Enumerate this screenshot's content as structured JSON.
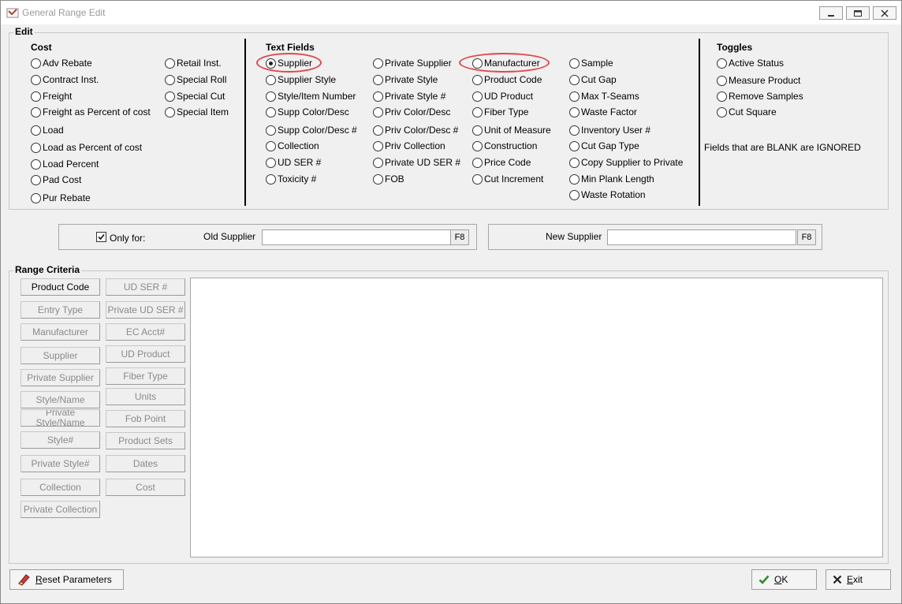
{
  "window": {
    "title": "General Range Edit"
  },
  "edit_group": {
    "legend": "Edit"
  },
  "cost": {
    "heading": "Cost",
    "col1": [
      "Adv Rebate",
      "Contract Inst.",
      "Freight",
      "Freight as Percent of cost",
      "Load",
      "Load as Percent of cost",
      "Load Percent",
      "Pad Cost",
      "Pur Rebate"
    ],
    "col2": [
      "Retail Inst.",
      "Special Roll",
      "Special Cut",
      "Special Item"
    ]
  },
  "text_fields": {
    "heading": "Text Fields",
    "col1": [
      "Supplier",
      "Supplier Style",
      "Style/Item Number",
      "Supp Color/Desc",
      "Supp Color/Desc #",
      "Collection",
      "UD SER #",
      "Toxicity #"
    ],
    "col2": [
      "Private Supplier",
      "Private Style",
      "Private Style #",
      "Priv Color/Desc",
      "Priv Color/Desc #",
      "Priv Collection",
      "Private UD SER #",
      "FOB"
    ],
    "col3": [
      "Manufacturer",
      "Product Code",
      "UD Product",
      "Fiber Type",
      "Unit of Measure",
      "Construction",
      "Price Code",
      "Cut Increment"
    ],
    "col4": [
      "Sample",
      "Cut Gap",
      "Max T-Seams",
      "Waste Factor",
      "Inventory User #",
      "Cut Gap Type",
      "Copy Supplier to Private",
      "Min Plank Length",
      "Waste Rotation"
    ],
    "selected": "Supplier"
  },
  "toggles": {
    "heading": "Toggles",
    "items": [
      "Active Status",
      "Measure Product",
      "Remove Samples",
      "Cut Square"
    ],
    "note": "Fields that are BLANK are IGNORED"
  },
  "old_panel": {
    "checkbox_label": "Only for:",
    "checked": true,
    "field_label": "Old Supplier",
    "value": "",
    "lookup": "F8"
  },
  "new_panel": {
    "field_label": "New Supplier",
    "value": "",
    "lookup": "F8"
  },
  "range_criteria": {
    "legend": "Range Criteria",
    "col1": [
      "Product Code",
      "Entry Type",
      "Manufacturer",
      "Supplier",
      "Private Supplier",
      "Style/Name",
      "Private Style/Name",
      "Style#",
      "Private Style#",
      "Collection",
      "Private Collection"
    ],
    "col2": [
      "UD SER #",
      "Private UD SER #",
      "EC Acct#",
      "UD Product",
      "Fiber Type",
      "Units",
      "Fob Point",
      "Product Sets",
      "Dates",
      "Cost"
    ]
  },
  "footer": {
    "reset_label": "Reset Parameters",
    "reset_mnemonic": "R",
    "reset_rest": "eset Parameters",
    "ok_mnemonic": "O",
    "ok_rest": "K",
    "exit_mnemonic": "E",
    "exit_rest": "xit"
  },
  "colors": {
    "highlight": "#e0474c",
    "disabled_text": "#8a8a8a",
    "ok_check": "#2e8b2e",
    "exit_x": "#222222"
  }
}
